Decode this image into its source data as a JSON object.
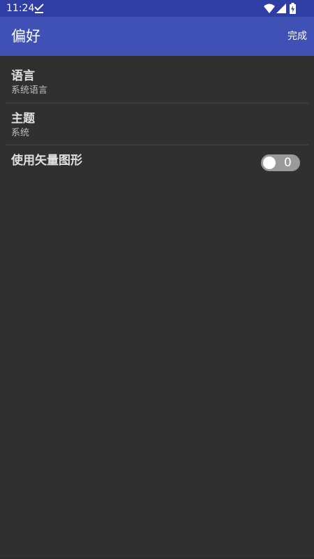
{
  "status_bar": {
    "time": "11:24",
    "icons": [
      "download-done-icon",
      "wifi-icon",
      "signal-icon",
      "battery-charging-icon"
    ],
    "color": "#2f3ea4"
  },
  "app_bar": {
    "title": "偏好",
    "done_label": "完成",
    "color": "#3f51b5"
  },
  "preferences": [
    {
      "title": "语言",
      "summary": "系统语言"
    },
    {
      "title": "主题",
      "summary": "系统"
    },
    {
      "title": "使用矢量图形",
      "toggle": {
        "state": "off",
        "label": "0"
      }
    }
  ],
  "colors": {
    "background": "#303030",
    "divider": "#454545"
  }
}
